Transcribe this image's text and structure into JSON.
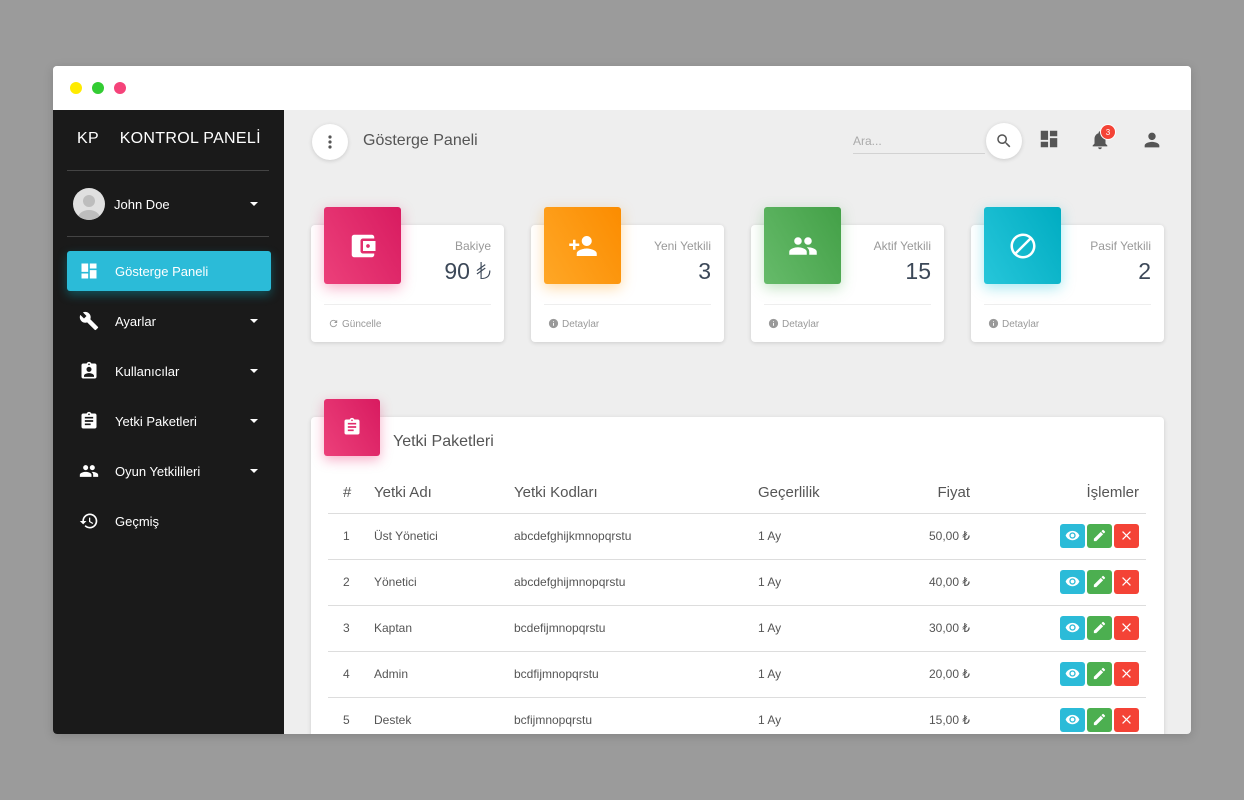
{
  "brand": {
    "logo": "KP",
    "title": "KONTROL PANELİ"
  },
  "user": {
    "name": "John Doe"
  },
  "sidebar": {
    "items": [
      {
        "label": "Gösterge Paneli",
        "icon": "dashboard-icon",
        "active": true
      },
      {
        "label": "Ayarlar",
        "icon": "wrench-icon"
      },
      {
        "label": "Kullanıcılar",
        "icon": "id-badge-icon"
      },
      {
        "label": "Yetki Paketleri",
        "icon": "clipboard-icon"
      },
      {
        "label": "Oyun Yetkilileri",
        "icon": "people-icon"
      },
      {
        "label": "Geçmiş",
        "icon": "history-icon"
      }
    ]
  },
  "topbar": {
    "title": "Gösterge Paneli",
    "search_placeholder": "Ara...",
    "notifications_count": "3"
  },
  "stats": [
    {
      "label": "Bakiye",
      "value": "90 ₺",
      "footer": "Güncelle",
      "color": "#e91e63",
      "icon": "wallet-icon",
      "footer_icon": "refresh-icon"
    },
    {
      "label": "Yeni Yetkili",
      "value": "3",
      "footer": "Detaylar",
      "color": "#ff9800",
      "icon": "add-person-icon",
      "footer_icon": "info-icon"
    },
    {
      "label": "Aktif Yetkili",
      "value": "15",
      "footer": "Detaylar",
      "color": "#4caf50",
      "icon": "people-icon",
      "footer_icon": "info-icon"
    },
    {
      "label": "Pasif Yetkili",
      "value": "2",
      "footer": "Detaylar",
      "color": "#26c6da",
      "icon": "block-icon",
      "footer_icon": "info-icon"
    }
  ],
  "packages": {
    "title": "Yetki Paketleri",
    "headers": [
      "#",
      "Yetki Adı",
      "Yetki Kodları",
      "Geçerlilik",
      "Fiyat",
      "İşlemler"
    ],
    "rows": [
      {
        "num": "1",
        "name": "Üst Yönetici",
        "codes": "abcdefghijkmnopqrstu",
        "validity": "1 Ay",
        "price": "50,00 ₺"
      },
      {
        "num": "2",
        "name": "Yönetici",
        "codes": "abcdefghijmnopqrstu",
        "validity": "1 Ay",
        "price": "40,00 ₺"
      },
      {
        "num": "3",
        "name": "Kaptan",
        "codes": "bcdefijmnopqrstu",
        "validity": "1 Ay",
        "price": "30,00 ₺"
      },
      {
        "num": "4",
        "name": "Admin",
        "codes": "bcdfijmnopqrstu",
        "validity": "1 Ay",
        "price": "20,00 ₺"
      },
      {
        "num": "5",
        "name": "Destek",
        "codes": "bcfijmnopqrstu",
        "validity": "1 Ay",
        "price": "15,00 ₺"
      }
    ]
  },
  "colors": {
    "sidebar_bg": "#1a1a1a",
    "active_item": "#2bbbd8",
    "view_button": "#2bbbd8",
    "edit_button": "#4caf50",
    "delete_button": "#f44336",
    "window_dot_yellow": "#ffeb00",
    "window_dot_green": "#33cc33",
    "window_dot_pink": "#f5437a"
  }
}
